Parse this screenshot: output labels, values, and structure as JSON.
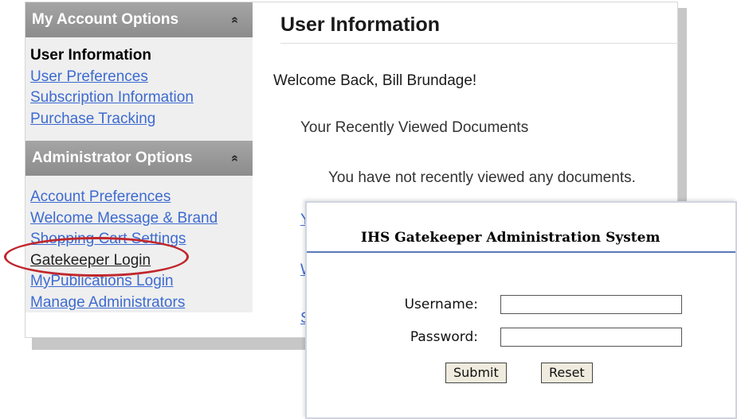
{
  "sidebar": {
    "account_section": {
      "title": "My Account Options",
      "items": [
        {
          "label": "User Information"
        },
        {
          "label": "User Preferences"
        },
        {
          "label": "Subscription Information"
        },
        {
          "label": "Purchase Tracking"
        }
      ]
    },
    "admin_section": {
      "title": "Administrator Options",
      "items": [
        {
          "label": "Account Preferences"
        },
        {
          "label": "Welcome Message & Brand"
        },
        {
          "label": "Shopping Cart Settings"
        },
        {
          "label": "Gatekeeper Login"
        },
        {
          "label": "MyPublications Login"
        },
        {
          "label": "Manage Administrators"
        }
      ]
    },
    "collapse_glyph": "»"
  },
  "main": {
    "title": "User Information",
    "welcome": "Welcome Back, Bill Brundage!",
    "recent_title": "Your Recently Viewed Documents",
    "recent_empty": "You have not recently viewed any documents.",
    "partial_links": [
      "Yo",
      "W",
      "S"
    ]
  },
  "login_dialog": {
    "title": "IHS Gatekeeper Administration System",
    "username_label": "Username:",
    "username_value": "",
    "password_label": "Password:",
    "password_value": "",
    "submit_label": "Submit",
    "reset_label": "Reset"
  },
  "colors": {
    "highlight": "#c0272d",
    "link": "#3d6bd1",
    "divider": "#5b79b8"
  }
}
